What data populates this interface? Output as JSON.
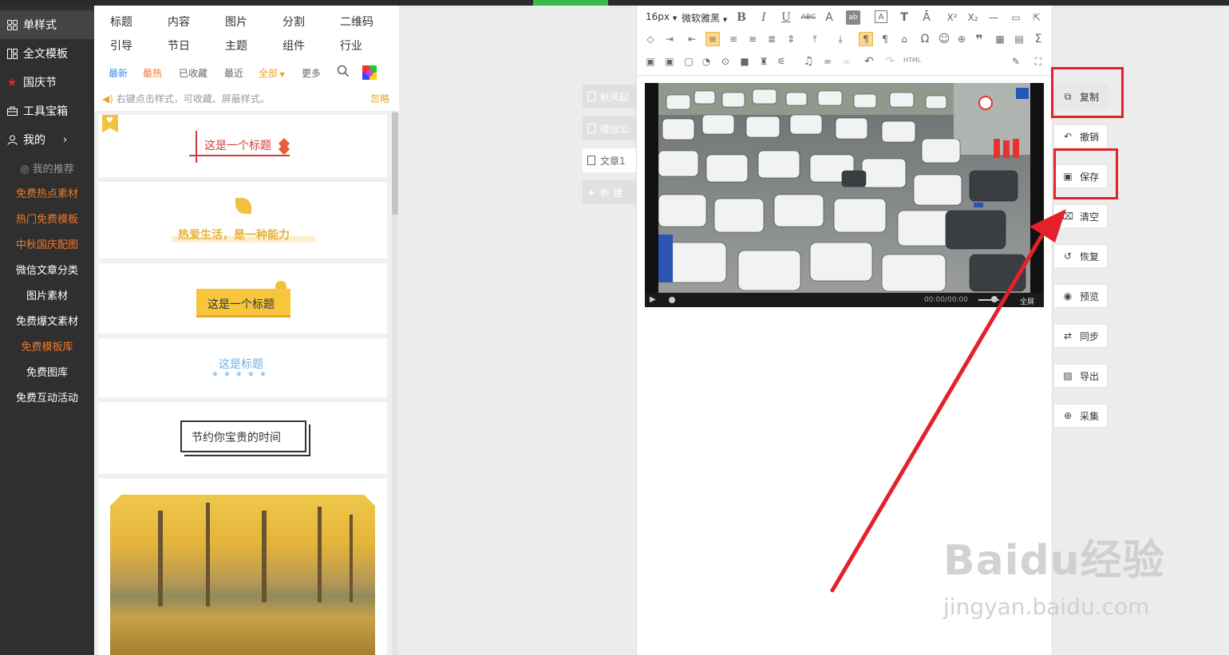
{
  "nav": {
    "items": [
      {
        "label": "单样式",
        "icon": "grid-icon"
      },
      {
        "label": "全文模板",
        "icon": "layout-icon"
      },
      {
        "label": "国庆节",
        "icon": "star-icon"
      },
      {
        "label": "工具宝箱",
        "icon": "toolbox-icon"
      },
      {
        "label": "我的",
        "icon": "user-icon"
      }
    ],
    "recommend": "我的推荐",
    "links": [
      "免费热点素材",
      "热门免费模板",
      "中秋国庆配图",
      "微信文章分类",
      "图片素材",
      "免费爆文素材",
      "免费模板库",
      "免费图库",
      "免费互动活动"
    ]
  },
  "panel": {
    "categories_row1": [
      "标题",
      "内容",
      "图片",
      "分割",
      "二维码"
    ],
    "categories_row2": [
      "引导",
      "节日",
      "主题",
      "组件",
      "行业"
    ],
    "filters": [
      "最新",
      "最热",
      "已收藏",
      "最近",
      "全部",
      "更多"
    ],
    "tip": "右键点击样式，可收藏、屏蔽样式。",
    "ignore": "忽略",
    "cards": [
      "这是一个标题",
      "热爱生活，是一种能力",
      "这是一个标题",
      "这是标题",
      "节约你宝贵的时间"
    ]
  },
  "doc_tabs": [
    "秋风起",
    "微信公",
    "文章1",
    "新 建"
  ],
  "editor": {
    "font_size": "16px",
    "font_family": "微软雅黑",
    "html_label": "HTML",
    "video_time": "00:00/00:00",
    "fullscreen": "全屏"
  },
  "actions": [
    "复制",
    "撤销",
    "保存",
    "清空",
    "恢复",
    "预览",
    "同步",
    "导出",
    "采集"
  ],
  "watermark": {
    "brand": "Baidu经验",
    "url": "jingyan.baidu.com"
  },
  "colors": {
    "accent_red": "#e4212a",
    "orange": "#f0782a",
    "green": "#3cb84a"
  }
}
